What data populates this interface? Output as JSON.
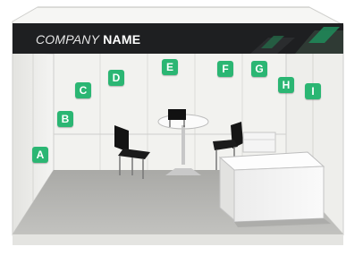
{
  "fascia": {
    "company": "COMPANY",
    "name": "NAME"
  },
  "panel_markers": [
    "A",
    "B",
    "C",
    "D",
    "E",
    "F",
    "G",
    "H",
    "I"
  ],
  "colors": {
    "marker": "#2bb673",
    "fascia": "#1e1f21",
    "floor": "#b7b7b4",
    "wall": "#f1f1ee"
  }
}
